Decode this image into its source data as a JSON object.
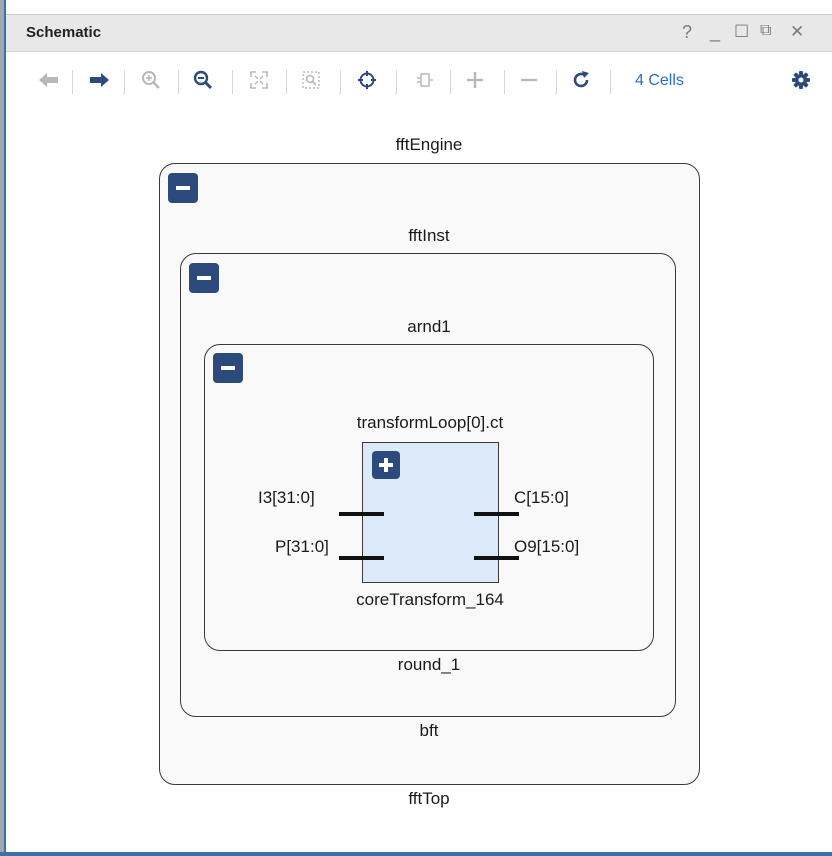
{
  "window": {
    "title": "Schematic",
    "controls": [
      "?",
      "_",
      "☐",
      "⧉",
      "✕"
    ]
  },
  "toolbar": {
    "buttons": [
      {
        "name": "back-arrow-icon",
        "enabled": false
      },
      {
        "name": "forward-arrow-icon",
        "enabled": true
      },
      {
        "name": "zoom-in-icon",
        "enabled": false
      },
      {
        "name": "zoom-out-icon",
        "enabled": true
      },
      {
        "name": "zoom-fit-icon",
        "enabled": false
      },
      {
        "name": "zoom-area-icon",
        "enabled": false
      },
      {
        "name": "select-target-icon",
        "enabled": true
      },
      {
        "name": "expand-cell-icon",
        "enabled": false
      },
      {
        "name": "plus-icon",
        "enabled": false
      },
      {
        "name": "minus-icon",
        "enabled": false
      },
      {
        "name": "refresh-icon",
        "enabled": true
      }
    ],
    "cells_label": "4 Cells",
    "settings_icon": "gear-icon"
  },
  "schematic": {
    "levels": [
      {
        "label_top": "fftEngine",
        "label_bottom": "fftTop",
        "toggle": "−",
        "state": "expanded"
      },
      {
        "label_top": "fftInst",
        "label_bottom": "bft",
        "toggle": "−",
        "state": "expanded"
      },
      {
        "label_top": "arnd1",
        "label_bottom": "round_1",
        "toggle": "−",
        "state": "expanded"
      }
    ],
    "cell": {
      "label_top": "transformLoop[0].ct",
      "label_bottom": "coreTransform_164",
      "toggle": "+",
      "state": "collapsed",
      "inputs": [
        "I3[31:0]",
        "P[31:0]"
      ],
      "outputs": [
        "C[15:0]",
        "O9[15:0]"
      ]
    }
  },
  "colors": {
    "accent_blue": "#2b6fc2",
    "toggle_bg": "#2c4a7c",
    "cell_fill": "#dce9f8",
    "border_accent": "#3c6ea8"
  }
}
